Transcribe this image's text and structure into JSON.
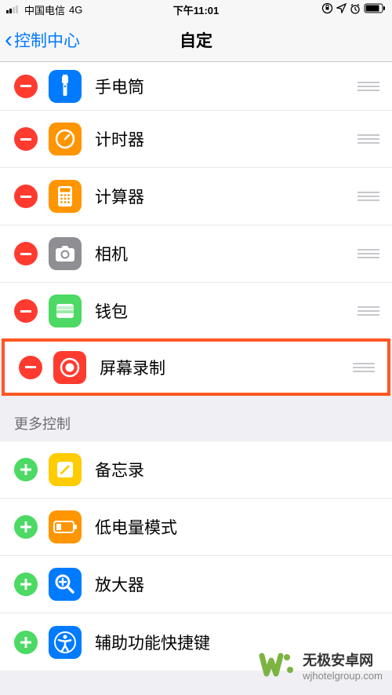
{
  "statusBar": {
    "carrier": "中国电信",
    "network": "4G",
    "time": "下午11:01"
  },
  "nav": {
    "backLabel": "控制中心",
    "title": "自定"
  },
  "included": [
    {
      "label": "手电筒",
      "iconBg": "#007aff",
      "iconName": "flashlight"
    },
    {
      "label": "计时器",
      "iconBg": "#ff9500",
      "iconName": "timer"
    },
    {
      "label": "计算器",
      "iconBg": "#ff9500",
      "iconName": "calculator"
    },
    {
      "label": "相机",
      "iconBg": "#8e8e93",
      "iconName": "camera"
    },
    {
      "label": "钱包",
      "iconBg": "#4cd964",
      "iconName": "wallet"
    },
    {
      "label": "屏幕录制",
      "iconBg": "#ff3b30",
      "iconName": "record",
      "highlighted": true
    }
  ],
  "sectionHeader": "更多控制",
  "more": [
    {
      "label": "备忘录",
      "iconBg": "#ffcc00",
      "iconName": "notes"
    },
    {
      "label": "低电量模式",
      "iconBg": "#ff9500",
      "iconName": "battery"
    },
    {
      "label": "放大器",
      "iconBg": "#007aff",
      "iconName": "magnifier"
    },
    {
      "label": "辅助功能快捷键",
      "iconBg": "#007aff",
      "iconName": "accessibility"
    }
  ],
  "watermark": {
    "title": "无极安卓网",
    "url": "wjhotelgroup.com"
  }
}
